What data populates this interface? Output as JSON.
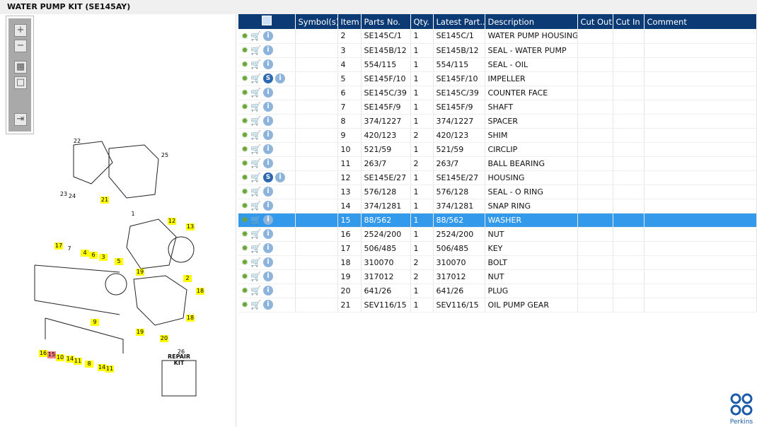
{
  "title": "WATER PUMP KIT (SE145AY)",
  "toolbar": {
    "zoom_in": "+",
    "zoom_out": "−",
    "fit": "▦",
    "actual": "□",
    "export": "⇥"
  },
  "diagram": {
    "labels": [
      "22",
      "25",
      "23",
      "24",
      "21",
      "1",
      "12",
      "13",
      "17",
      "7",
      "4",
      "6",
      "3",
      "5",
      "19",
      "2",
      "18",
      "9",
      "16",
      "15",
      "10",
      "14",
      "11",
      "8",
      "14",
      "11",
      "19",
      "20",
      "18",
      "26"
    ],
    "repair_kit": "REPAIR KIT"
  },
  "columns": [
    "",
    "Symbol(s)",
    "Item",
    "Parts No.",
    "Qty.",
    "Latest Part...",
    "Description",
    "Cut Out",
    "Cut In",
    "Comment"
  ],
  "rows": [
    {
      "s": false,
      "item": "2",
      "part": "SE145C/1",
      "qty": "1",
      "latest": "SE145C/1",
      "desc": "WATER PUMP HOUSING"
    },
    {
      "s": false,
      "item": "3",
      "part": "SE145B/12",
      "qty": "1",
      "latest": "SE145B/12",
      "desc": "SEAL - WATER PUMP"
    },
    {
      "s": false,
      "item": "4",
      "part": "554/115",
      "qty": "1",
      "latest": "554/115",
      "desc": "SEAL - OIL"
    },
    {
      "s": true,
      "item": "5",
      "part": "SE145F/10",
      "qty": "1",
      "latest": "SE145F/10",
      "desc": "IMPELLER"
    },
    {
      "s": false,
      "item": "6",
      "part": "SE145C/39",
      "qty": "1",
      "latest": "SE145C/39",
      "desc": "COUNTER FACE"
    },
    {
      "s": false,
      "item": "7",
      "part": "SE145F/9",
      "qty": "1",
      "latest": "SE145F/9",
      "desc": "SHAFT"
    },
    {
      "s": false,
      "item": "8",
      "part": "374/1227",
      "qty": "1",
      "latest": "374/1227",
      "desc": "SPACER"
    },
    {
      "s": false,
      "item": "9",
      "part": "420/123",
      "qty": "2",
      "latest": "420/123",
      "desc": "SHIM"
    },
    {
      "s": false,
      "item": "10",
      "part": "521/59",
      "qty": "1",
      "latest": "521/59",
      "desc": "CIRCLIP"
    },
    {
      "s": false,
      "item": "11",
      "part": "263/7",
      "qty": "2",
      "latest": "263/7",
      "desc": "BALL BEARING"
    },
    {
      "s": true,
      "item": "12",
      "part": "SE145E/27",
      "qty": "1",
      "latest": "SE145E/27",
      "desc": "HOUSING"
    },
    {
      "s": false,
      "item": "13",
      "part": "576/128",
      "qty": "1",
      "latest": "576/128",
      "desc": "SEAL - O RING"
    },
    {
      "s": false,
      "item": "14",
      "part": "374/1281",
      "qty": "1",
      "latest": "374/1281",
      "desc": "SNAP RING"
    },
    {
      "s": false,
      "item": "15",
      "part": "88/562",
      "qty": "1",
      "latest": "88/562",
      "desc": "WASHER",
      "selected": true
    },
    {
      "s": false,
      "item": "16",
      "part": "2524/200",
      "qty": "1",
      "latest": "2524/200",
      "desc": "NUT"
    },
    {
      "s": false,
      "item": "17",
      "part": "506/485",
      "qty": "1",
      "latest": "506/485",
      "desc": "KEY"
    },
    {
      "s": false,
      "item": "18",
      "part": "310070",
      "qty": "2",
      "latest": "310070",
      "desc": "BOLT"
    },
    {
      "s": false,
      "item": "19",
      "part": "317012",
      "qty": "2",
      "latest": "317012",
      "desc": "NUT"
    },
    {
      "s": false,
      "item": "20",
      "part": "641/26",
      "qty": "1",
      "latest": "641/26",
      "desc": "PLUG"
    },
    {
      "s": false,
      "item": "21",
      "part": "SEV116/15",
      "qty": "1",
      "latest": "SEV116/15",
      "desc": "OIL PUMP GEAR"
    }
  ],
  "icons": {
    "gear": "✹",
    "cart": "🛒",
    "info": "i",
    "s": "S"
  },
  "brand": "Perkins",
  "colors": {
    "header": "#0b3a75",
    "selected": "#3399ea",
    "callout": "#ffff00"
  }
}
